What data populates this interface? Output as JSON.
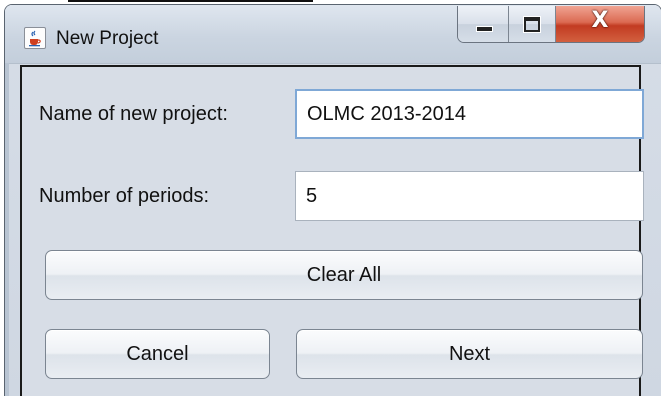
{
  "window": {
    "title": "New Project",
    "icon": "java-cup-icon",
    "controls": {
      "minimize": "minimize-icon",
      "maximize": "maximize-icon",
      "close": "X"
    }
  },
  "form": {
    "project_name_label": "Name of new project:",
    "project_name_value": "OLMC 2013-2014",
    "periods_label": "Number of periods:",
    "periods_value": "5"
  },
  "buttons": {
    "clear_all": "Clear All",
    "cancel": "Cancel",
    "next": "Next"
  },
  "colors": {
    "focus_border": "#7fa8d6",
    "close_button": "#c23b22"
  }
}
